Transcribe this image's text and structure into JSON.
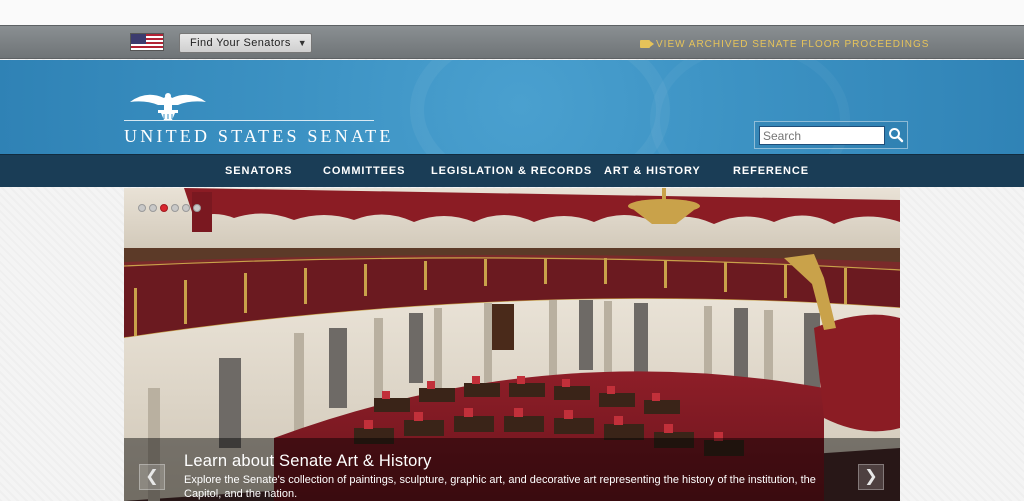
{
  "utility": {
    "find_label": "Find Your Senators",
    "archived_link": "VIEW ARCHIVED SENATE FLOOR PROCEEDINGS"
  },
  "header": {
    "logo_text": "UNITED STATES SENATE",
    "search_placeholder": "Search",
    "search_value": ""
  },
  "nav": {
    "items": [
      {
        "label": "SENATORS"
      },
      {
        "label": "COMMITTEES"
      },
      {
        "label": "LEGISLATION & RECORDS"
      },
      {
        "label": "ART & HISTORY"
      },
      {
        "label": "REFERENCE"
      }
    ]
  },
  "hero": {
    "slide_count": 6,
    "active_slide": 3,
    "title": "Learn about Senate Art & History",
    "description": "Explore the Senate's collection of paintings, sculpture, graphic art, and decorative art representing the history of the institution, the Capitol, and the nation.",
    "prev_icon": "chevron-left-icon",
    "next_icon": "chevron-right-icon"
  },
  "colors": {
    "banner_blue": "#3d93c4",
    "nav_navy": "#1a3d56",
    "utility_gray": "#7b8083",
    "archived_gold": "#e6c35a",
    "active_dot": "#d9262e"
  }
}
